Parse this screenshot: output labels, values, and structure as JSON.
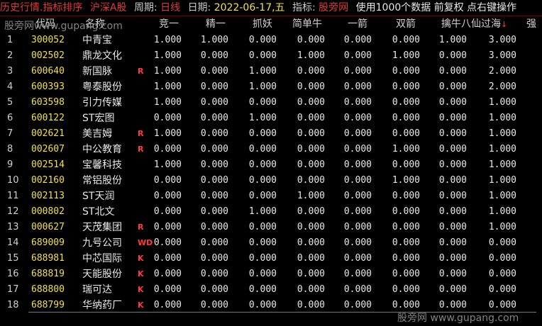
{
  "topbar": {
    "title": "历史行情.指标排序",
    "market": "沪深A股",
    "period_label": "周期:",
    "period_value": "日线",
    "date_label": "日期:",
    "date_value": "2022-06-17,五",
    "indicator_label": "指标:",
    "indicator_value": "股旁网",
    "usage": "使用1000个数据 前复权 点右键操作"
  },
  "watermarks": {
    "top_left": "股旁网www.gupang.com",
    "bottom_right": "股旁网 www.gupang.com"
  },
  "columns": [
    "代码",
    "名称",
    "竞一",
    "精一",
    "抓妖",
    "简单牛",
    "一箭",
    "双箭",
    "擒牛八仙过海",
    "强"
  ],
  "sort_indicator": "↓",
  "rows": [
    {
      "idx": "1",
      "code": "300052",
      "name": "中青宝",
      "flag": "",
      "v": [
        "1.000",
        "1.000",
        "0.000",
        "0.000",
        "0.000",
        "0.000",
        "1.000",
        "3.000"
      ]
    },
    {
      "idx": "2",
      "code": "002502",
      "name": "鼎龙文化",
      "flag": "",
      "v": [
        "1.000",
        "0.000",
        "0.000",
        "1.000",
        "0.000",
        "1.000",
        "0.000",
        "3.000"
      ]
    },
    {
      "idx": "3",
      "code": "600640",
      "name": "新国脉",
      "flag": "R",
      "v": [
        "1.000",
        "0.000",
        "1.000",
        "0.000",
        "0.000",
        "0.000",
        "0.000",
        "2.000"
      ]
    },
    {
      "idx": "4",
      "code": "600393",
      "name": "粤泰股份",
      "flag": "",
      "v": [
        "1.000",
        "0.000",
        "1.000",
        "0.000",
        "0.000",
        "0.000",
        "0.000",
        "2.000"
      ]
    },
    {
      "idx": "5",
      "code": "603598",
      "name": "引力传媒",
      "flag": "",
      "v": [
        "1.000",
        "0.000",
        "0.000",
        "0.000",
        "0.000",
        "0.000",
        "0.000",
        "1.000"
      ]
    },
    {
      "idx": "6",
      "code": "600122",
      "name": "ST宏图",
      "flag": "",
      "v": [
        "0.000",
        "0.000",
        "1.000",
        "0.000",
        "0.000",
        "0.000",
        "0.000",
        "1.000"
      ]
    },
    {
      "idx": "7",
      "code": "002621",
      "name": "美吉姆",
      "flag": "R",
      "v": [
        "1.000",
        "0.000",
        "0.000",
        "0.000",
        "0.000",
        "0.000",
        "0.000",
        "1.000"
      ]
    },
    {
      "idx": "8",
      "code": "002607",
      "name": "中公教育",
      "flag": "R",
      "v": [
        "0.000",
        "0.000",
        "0.000",
        "0.000",
        "0.000",
        "1.000",
        "0.000",
        "1.000"
      ]
    },
    {
      "idx": "9",
      "code": "002514",
      "name": "宝馨科技",
      "flag": "",
      "v": [
        "1.000",
        "0.000",
        "0.000",
        "0.000",
        "0.000",
        "0.000",
        "0.000",
        "1.000"
      ]
    },
    {
      "idx": "10",
      "code": "002160",
      "name": "常铝股份",
      "flag": "",
      "v": [
        "0.000",
        "0.000",
        "0.000",
        "0.000",
        "0.000",
        "1.000",
        "0.000",
        "1.000"
      ]
    },
    {
      "idx": "11",
      "code": "002113",
      "name": "ST天润",
      "flag": "",
      "v": [
        "0.000",
        "0.000",
        "0.000",
        "1.000",
        "0.000",
        "0.000",
        "0.000",
        "1.000"
      ]
    },
    {
      "idx": "12",
      "code": "000802",
      "name": "ST北文",
      "flag": "",
      "v": [
        "0.000",
        "0.000",
        "1.000",
        "0.000",
        "0.000",
        "0.000",
        "0.000",
        "1.000"
      ]
    },
    {
      "idx": "13",
      "code": "000627",
      "name": "天茂集团",
      "flag": "R",
      "v": [
        "0.000",
        "0.000",
        "0.000",
        "0.000",
        "0.000",
        "0.000",
        "0.000",
        "1.000"
      ]
    },
    {
      "idx": "14",
      "code": "689009",
      "name": "九号公司",
      "flag": "WD",
      "v": [
        "0.000",
        "0.000",
        "0.000",
        "0.000",
        "0.000",
        "0.000",
        "0.000",
        "0.000"
      ]
    },
    {
      "idx": "15",
      "code": "688981",
      "name": "中芯国际",
      "flag": "K",
      "v": [
        "0.000",
        "0.000",
        "0.000",
        "0.000",
        "0.000",
        "0.000",
        "0.000",
        "0.000"
      ]
    },
    {
      "idx": "16",
      "code": "688819",
      "name": "天能股份",
      "flag": "K",
      "v": [
        "0.000",
        "0.000",
        "0.000",
        "0.000",
        "0.000",
        "0.000",
        "0.000",
        "0.000"
      ]
    },
    {
      "idx": "17",
      "code": "688800",
      "name": "瑞可达",
      "flag": "K",
      "v": [
        "0.000",
        "0.000",
        "0.000",
        "0.000",
        "0.000",
        "0.000",
        "0.000",
        "0.000"
      ]
    },
    {
      "idx": "18",
      "code": "688799",
      "name": "华纳药厂",
      "flag": "K",
      "v": [
        "0.000",
        "0.000",
        "0.000",
        "0.000",
        "0.000",
        "0.000",
        "0.000",
        "0.000"
      ]
    }
  ]
}
